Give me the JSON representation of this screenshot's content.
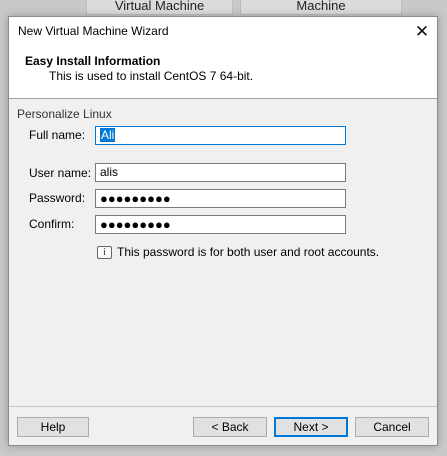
{
  "background_tabs": [
    "Virtual Machine",
    "Machine"
  ],
  "window": {
    "title": "New Virtual Machine Wizard",
    "close_glyph": "✕"
  },
  "header": {
    "title": "Easy Install Information",
    "subtitle": "This is used to install CentOS 7 64-bit."
  },
  "group": {
    "label": "Personalize Linux"
  },
  "fields": {
    "full_name": {
      "label": "Full name:",
      "value": "Ali"
    },
    "user_name": {
      "label": "User name:",
      "value": "alis"
    },
    "password": {
      "label": "Password:",
      "value": "●●●●●●●●●"
    },
    "confirm": {
      "label": "Confirm:",
      "value": "●●●●●●●●●"
    }
  },
  "info": {
    "icon": "info-icon",
    "icon_glyph": "i",
    "text": "This password is for both user and root accounts."
  },
  "buttons": {
    "help": "Help",
    "back": "< Back",
    "next": "Next >",
    "cancel": "Cancel"
  },
  "colors": {
    "accent": "#0078d7",
    "dialog_bg": "#f0f0f0",
    "header_bg": "#ffffff"
  }
}
